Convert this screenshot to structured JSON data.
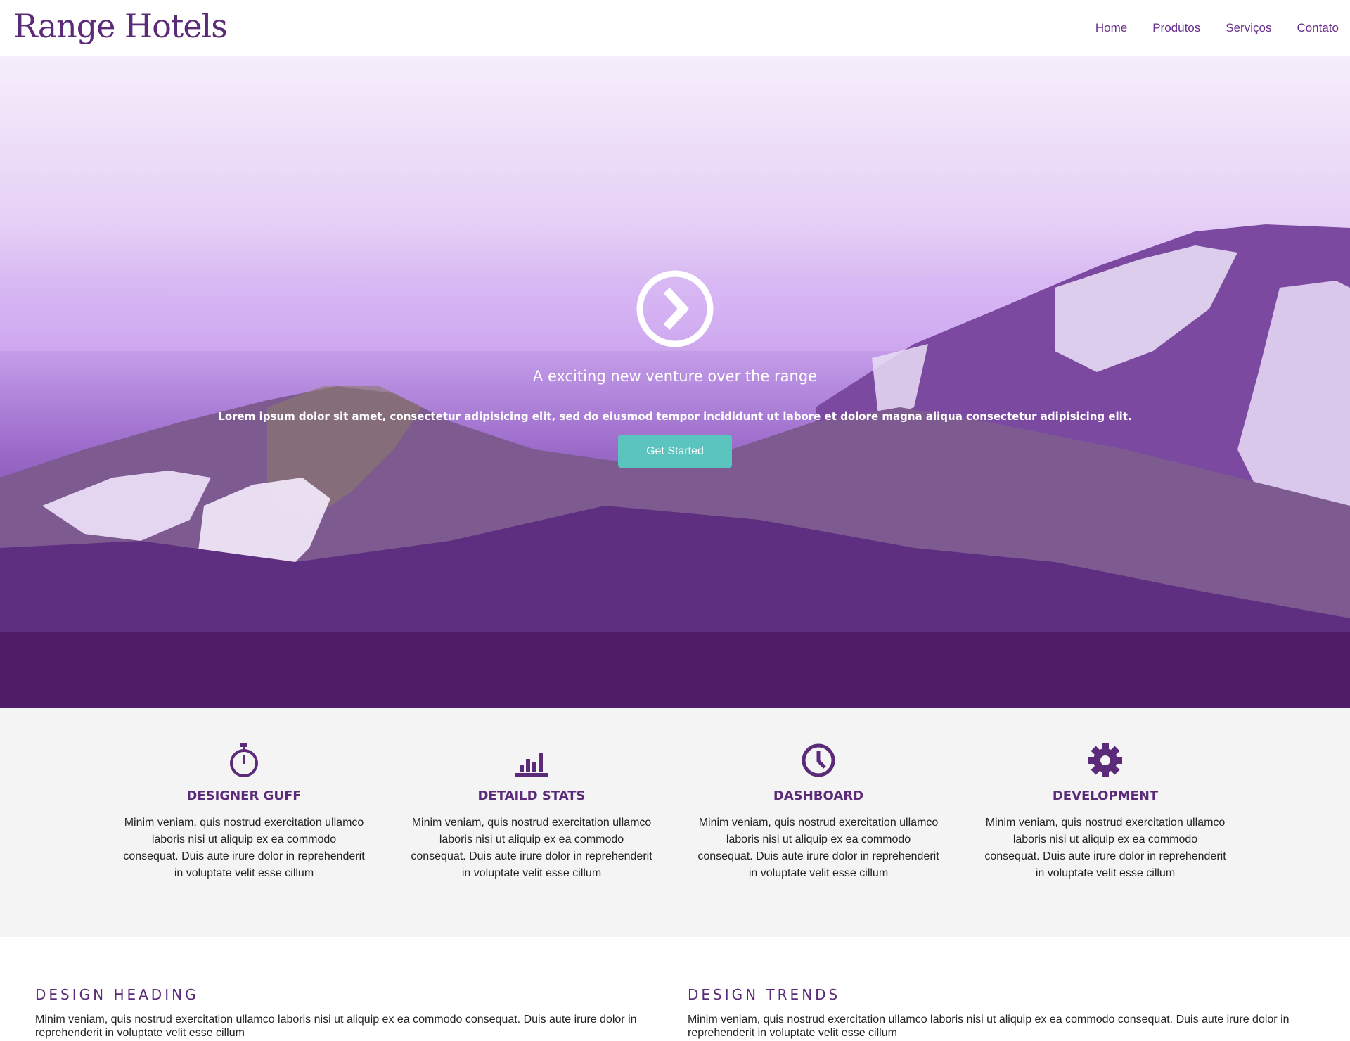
{
  "brand": {
    "logo": "Range Hotels",
    "accent": "#5b2a78",
    "button_color": "#5bc4bf"
  },
  "nav": {
    "items": [
      "Home",
      "Produtos",
      "Serviços",
      "Contato"
    ]
  },
  "hero": {
    "icon": "chevron-right-circle-icon",
    "title": "A exciting new venture over the range",
    "subtitle": "Lorem ipsum dolor sit amet, consectetur adipisicing elit, sed do eiusmod tempor incididunt ut labore et dolore magna aliqua consectetur adipisicing elit.",
    "button": "Get Started"
  },
  "features": [
    {
      "icon": "stopwatch-icon",
      "title": "DESIGNER GUFF",
      "text": "Minim veniam, quis nostrud exercitation ullamco laboris nisi ut aliquip ex ea commodo consequat. Duis aute irure dolor in reprehenderit in voluptate velit esse cillum"
    },
    {
      "icon": "bar-chart-icon",
      "title": "DETAILD STATS",
      "text": "Minim veniam, quis nostrud exercitation ullamco laboris nisi ut aliquip ex ea commodo consequat. Duis aute irure dolor in reprehenderit in voluptate velit esse cillum"
    },
    {
      "icon": "clock-icon",
      "title": "DASHBOARD",
      "text": "Minim veniam, quis nostrud exercitation ullamco laboris nisi ut aliquip ex ea commodo consequat. Duis aute irure dolor in reprehenderit in voluptate velit esse cillum"
    },
    {
      "icon": "gear-icon",
      "title": "DEVELOPMENT",
      "text": "Minim veniam, quis nostrud exercitation ullamco laboris nisi ut aliquip ex ea commodo consequat. Duis aute irure dolor in reprehenderit in voluptate velit esse cillum"
    }
  ],
  "sections": [
    {
      "heading": "DESIGN HEADING",
      "text": "Minim veniam, quis nostrud exercitation ullamco laboris nisi ut aliquip ex ea commodo consequat. Duis aute irure dolor in reprehenderit in voluptate velit esse cillum"
    },
    {
      "heading": "DESIGN TRENDS",
      "text": "Minim veniam, quis nostrud exercitation ullamco laboris nisi ut aliquip ex ea commodo consequat. Duis aute irure dolor in reprehenderit in voluptate velit esse cillum"
    }
  ]
}
